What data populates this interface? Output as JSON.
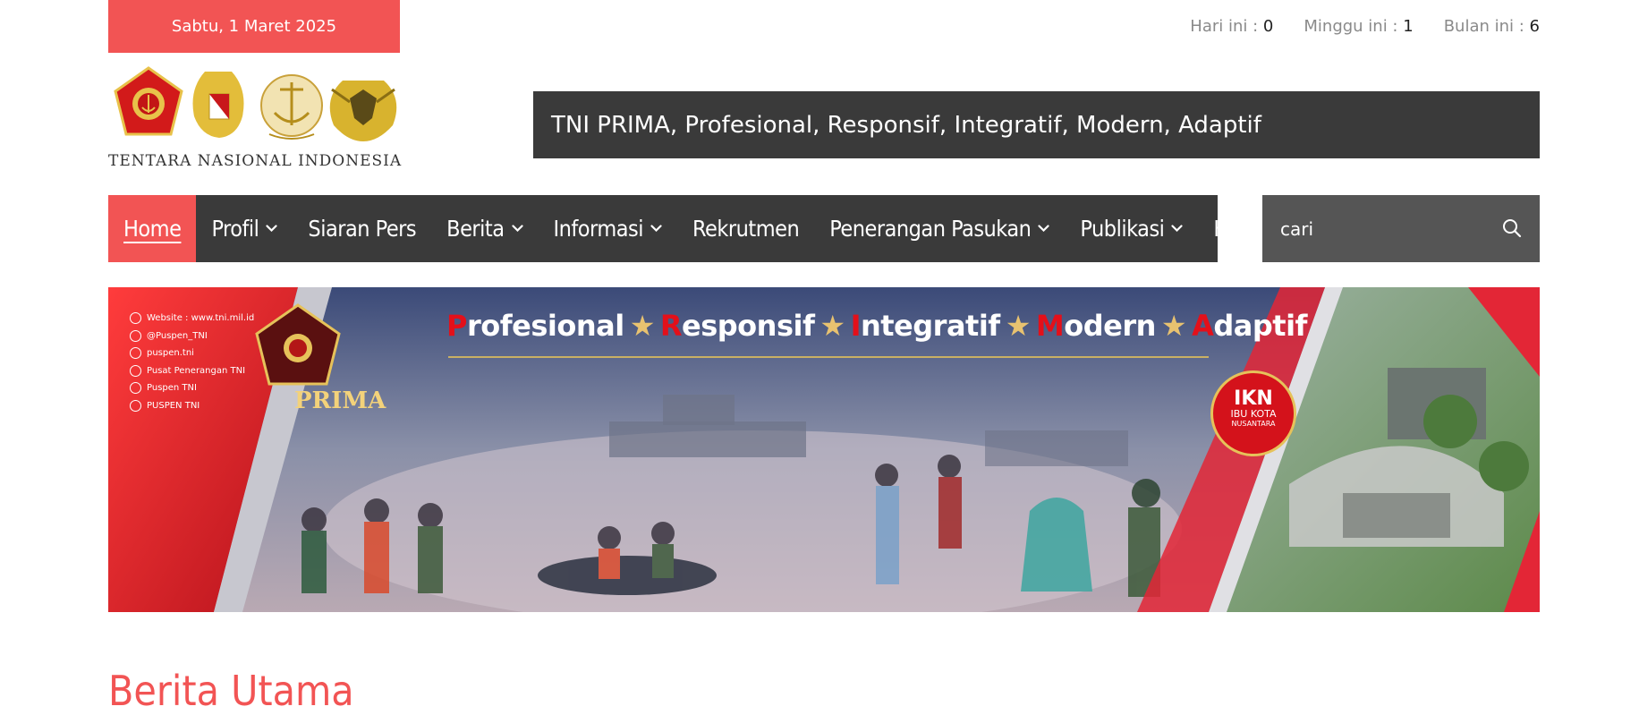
{
  "topbar": {
    "date": "Sabtu, 1 Maret 2025",
    "stats": [
      {
        "label": "Hari ini :",
        "value": "0"
      },
      {
        "label": "Minggu ini :",
        "value": "1"
      },
      {
        "label": "Bulan ini :",
        "value": "6"
      }
    ]
  },
  "logo": {
    "text": "TENTARA NASIONAL INDONESIA",
    "emblems": [
      "tni-emblem-icon",
      "army-emblem-icon",
      "navy-emblem-icon",
      "airforce-emblem-icon"
    ]
  },
  "tagline": "TNI PRIMA, Profesional, Responsif, Integratif, Modern, Adaptif",
  "nav": {
    "items": [
      {
        "label": "Home",
        "dropdown": false,
        "active": true
      },
      {
        "label": "Profil",
        "dropdown": true
      },
      {
        "label": "Siaran Pers",
        "dropdown": false
      },
      {
        "label": "Berita",
        "dropdown": true
      },
      {
        "label": "Informasi",
        "dropdown": true
      },
      {
        "label": "Rekrutmen",
        "dropdown": false
      },
      {
        "label": "Penerangan Pasukan",
        "dropdown": true
      },
      {
        "label": "Publikasi",
        "dropdown": true
      },
      {
        "label": "Kontak",
        "dropdown": false
      }
    ]
  },
  "search": {
    "placeholder": "cari",
    "icon": "search-icon"
  },
  "banner": {
    "social": [
      {
        "icon": "globe-icon",
        "text": "Website : www.tni.mil.id"
      },
      {
        "icon": "x-icon",
        "text": "@Puspen_TNI"
      },
      {
        "icon": "instagram-icon",
        "text": "puspen.tni"
      },
      {
        "icon": "facebook-icon",
        "text": "Pusat Penerangan TNI"
      },
      {
        "icon": "youtube-icon",
        "text": "Puspen TNI"
      },
      {
        "icon": "tiktok-icon",
        "text": "PUSPEN TNI"
      }
    ],
    "prima": "PRIMA",
    "slogan": [
      {
        "first": "P",
        "rest": "rofesional"
      },
      {
        "first": "R",
        "rest": "esponsif"
      },
      {
        "first": "I",
        "rest": "ntegratif"
      },
      {
        "first": "M",
        "rest": "odern"
      },
      {
        "first": "A",
        "rest": "daptif"
      }
    ],
    "ikn": {
      "big": "IKN",
      "mid": "IBU KOTA",
      "small": "NUSANTARA"
    }
  },
  "section": {
    "title": "Berita Utama"
  },
  "colors": {
    "accent": "#f25454",
    "dark": "#3a3a3a",
    "search_bg": "#555555"
  }
}
